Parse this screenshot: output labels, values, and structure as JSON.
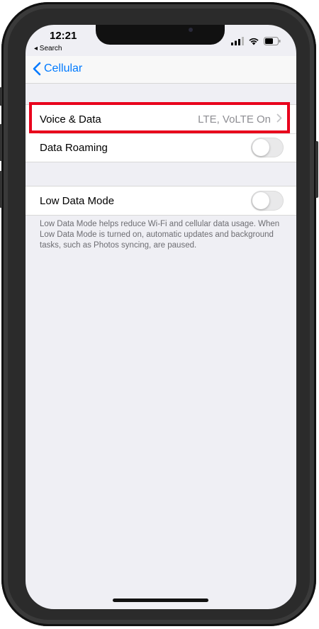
{
  "status_bar": {
    "time": "12:21",
    "back_app": "◂ Search",
    "icons": [
      "signal-icon",
      "wifi-icon",
      "battery-icon"
    ]
  },
  "nav": {
    "back_label": "Cellular"
  },
  "group1": {
    "rows": [
      {
        "label": "Voice & Data",
        "value": "LTE, VoLTE On",
        "highlighted": true
      },
      {
        "label": "Data Roaming",
        "toggle_on": false
      }
    ]
  },
  "group2": {
    "rows": [
      {
        "label": "Low Data Mode",
        "toggle_on": false
      }
    ],
    "footer": "Low Data Mode helps reduce Wi-Fi and cellular data usage. When Low Data Mode is turned on, automatic updates and background tasks, such as Photos syncing, are paused."
  },
  "colors": {
    "accent": "#007aff",
    "highlight": "#e8001c",
    "background": "#efeff4"
  }
}
